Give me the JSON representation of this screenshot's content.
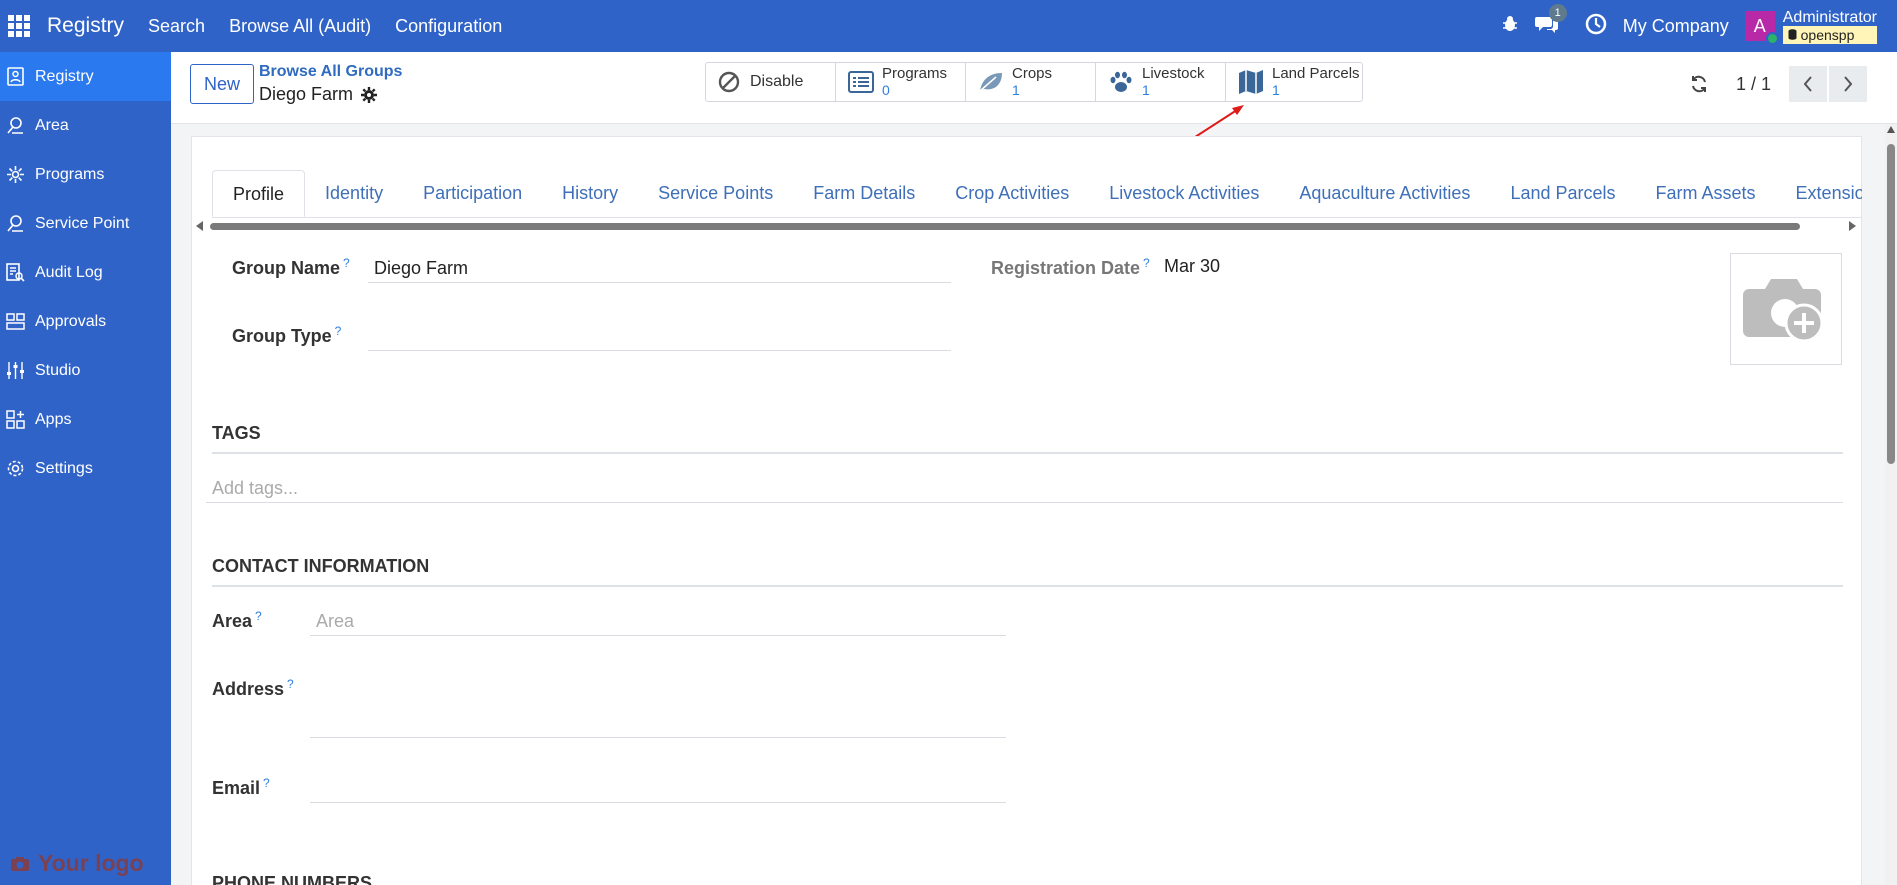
{
  "topbar": {
    "brand": "Registry",
    "nav": [
      "Search",
      "Browse All (Audit)",
      "Configuration"
    ],
    "messages_badge": "1",
    "company": "My Company",
    "avatar_letter": "A",
    "user_name": "Administrator",
    "database": "openspp"
  },
  "sidebar": {
    "items": [
      {
        "label": "Registry",
        "icon": "registry-icon",
        "active": true
      },
      {
        "label": "Area",
        "icon": "area-icon"
      },
      {
        "label": "Programs",
        "icon": "programs-icon"
      },
      {
        "label": "Service Point",
        "icon": "service-point-icon"
      },
      {
        "label": "Audit Log",
        "icon": "audit-log-icon"
      },
      {
        "label": "Approvals",
        "icon": "approvals-icon"
      },
      {
        "label": "Studio",
        "icon": "studio-icon"
      },
      {
        "label": "Apps",
        "icon": "apps-icon"
      },
      {
        "label": "Settings",
        "icon": "settings-icon"
      }
    ],
    "logo_text": "Your logo"
  },
  "control": {
    "new_label": "New",
    "breadcrumb": "Browse All Groups",
    "record_name": "Diego Farm",
    "disable_label": "Disable",
    "stats": [
      {
        "label": "Programs",
        "value": "0",
        "icon": "programs-list-icon"
      },
      {
        "label": "Crops",
        "value": "1",
        "icon": "leaf-icon"
      },
      {
        "label": "Livestock",
        "value": "1",
        "icon": "paw-icon"
      },
      {
        "label": "Land Parcels",
        "value": "1",
        "icon": "map-icon"
      }
    ],
    "pager_text": "1 / 1"
  },
  "tabs": [
    "Profile",
    "Identity",
    "Participation",
    "History",
    "Service Points",
    "Farm Details",
    "Crop Activities",
    "Livestock Activities",
    "Aquaculture Activities",
    "Land Parcels",
    "Farm Assets",
    "Extension Serv"
  ],
  "form": {
    "group_name_label": "Group Name",
    "group_name_value": "Diego Farm",
    "group_type_label": "Group Type",
    "registration_date_label": "Registration Date",
    "registration_date_value": "Mar 30",
    "help_mark": "?",
    "tags_heading": "TAGS",
    "tags_placeholder": "Add tags...",
    "contact_heading": "CONTACT INFORMATION",
    "area_label": "Area",
    "area_placeholder": "Area",
    "address_label": "Address",
    "email_label": "Email",
    "phone_heading": "PHONE NUMBERS"
  },
  "colors": {
    "topbar": "#3063c8",
    "sidebar_active": "#2a79ee",
    "link": "#2f7fe0",
    "annotation_arrow": "#e01919"
  }
}
